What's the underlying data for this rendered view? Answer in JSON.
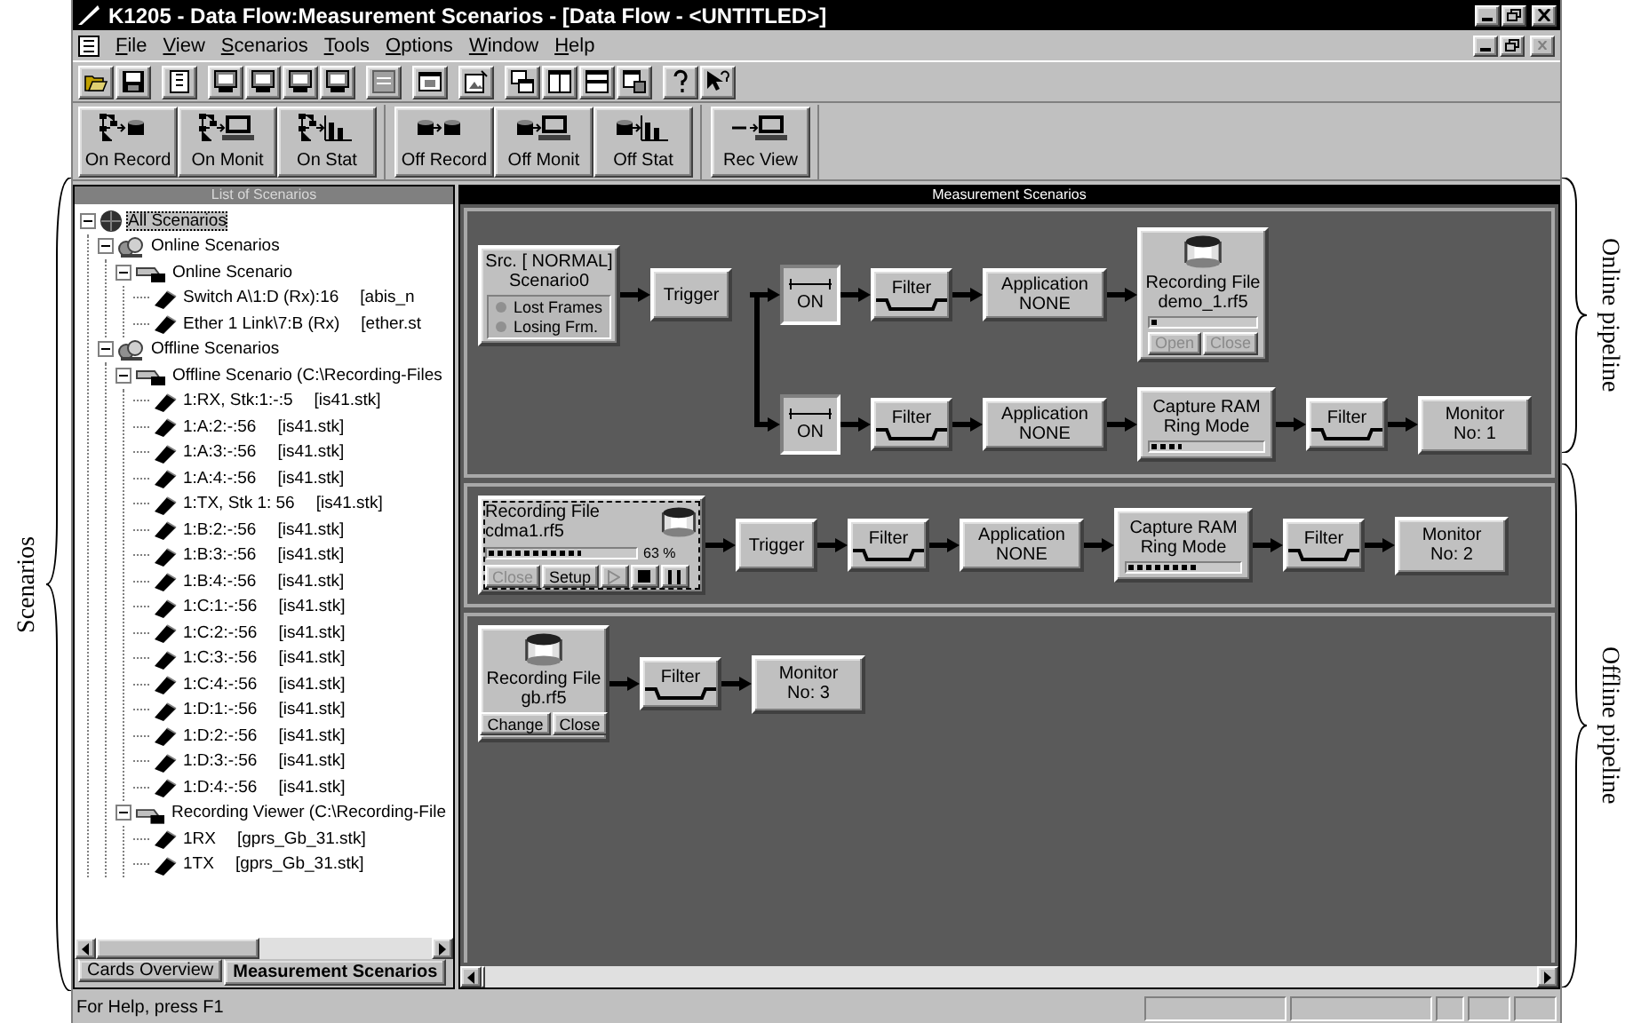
{
  "window": {
    "title": "K1205 - Data Flow:Measurement Scenarios - [Data Flow - <UNTITLED>]"
  },
  "menu": [
    {
      "label": "File"
    },
    {
      "label": "View"
    },
    {
      "label": "Scenarios"
    },
    {
      "label": "Tools"
    },
    {
      "label": "Options"
    },
    {
      "label": "Window"
    },
    {
      "label": "Help"
    }
  ],
  "button_groups": [
    [
      {
        "label": "On Record",
        "kind": "online_record"
      },
      {
        "label": "On Monit",
        "kind": "online_monitor"
      },
      {
        "label": "On Stat",
        "kind": "online_stat"
      }
    ],
    [
      {
        "label": "Off Record",
        "kind": "offline_record"
      },
      {
        "label": "Off Monit",
        "kind": "offline_monitor"
      },
      {
        "label": "Off Stat",
        "kind": "offline_stat"
      }
    ],
    [
      {
        "label": "Rec View",
        "kind": "viewer_monitor"
      }
    ]
  ],
  "scenario_list": {
    "title": "List of Scenarios",
    "tree": [
      {
        "kind": "root",
        "label": "All Scenarios",
        "selected": true,
        "expanded": true,
        "children": [
          {
            "kind": "group",
            "label": "Online Scenarios",
            "selected": false,
            "expanded": true,
            "children": [
              {
                "kind": "scenario",
                "label": "Online Scenario",
                "selected": false,
                "expanded": true,
                "children": [
                  {
                    "kind": "channel",
                    "label": "Switch A\\1:D (Rx):16",
                    "file": "[abis_n",
                    "selected": false
                  },
                  {
                    "kind": "channel",
                    "label": "Ether 1 Link\\7:B (Rx)",
                    "file": "[ether.st",
                    "selected": false
                  }
                ]
              }
            ]
          },
          {
            "kind": "group",
            "label": "Offline Scenarios",
            "selected": false,
            "expanded": true,
            "children": [
              {
                "kind": "scenario",
                "label": "Offline Scenario (C:\\Recording-Files",
                "selected": false,
                "expanded": true,
                "children": [
                  {
                    "kind": "channel",
                    "label": "1:RX, Stk:1:-:5",
                    "file": "[is41.stk]",
                    "selected": false
                  },
                  {
                    "kind": "channel",
                    "label": "1:A:2:-:56",
                    "file": "[is41.stk]",
                    "selected": false
                  },
                  {
                    "kind": "channel",
                    "label": "1:A:3:-:56",
                    "file": "[is41.stk]",
                    "selected": false
                  },
                  {
                    "kind": "channel",
                    "label": "1:A:4:-:56",
                    "file": "[is41.stk]",
                    "selected": false
                  },
                  {
                    "kind": "channel",
                    "label": "1:TX, Stk 1: 56",
                    "file": "[is41.stk]",
                    "selected": false
                  },
                  {
                    "kind": "channel",
                    "label": "1:B:2:-:56",
                    "file": "[is41.stk]",
                    "selected": false
                  },
                  {
                    "kind": "channel",
                    "label": "1:B:3:-:56",
                    "file": "[is41.stk]",
                    "selected": false
                  },
                  {
                    "kind": "channel",
                    "label": "1:B:4:-:56",
                    "file": "[is41.stk]",
                    "selected": false
                  },
                  {
                    "kind": "channel",
                    "label": "1:C:1:-:56",
                    "file": "[is41.stk]",
                    "selected": false
                  },
                  {
                    "kind": "channel",
                    "label": "1:C:2:-:56",
                    "file": "[is41.stk]",
                    "selected": false
                  },
                  {
                    "kind": "channel",
                    "label": "1:C:3:-:56",
                    "file": "[is41.stk]",
                    "selected": false
                  },
                  {
                    "kind": "channel",
                    "label": "1:C:4:-:56",
                    "file": "[is41.stk]",
                    "selected": false
                  },
                  {
                    "kind": "channel",
                    "label": "1:D:1:-:56",
                    "file": "[is41.stk]",
                    "selected": false
                  },
                  {
                    "kind": "channel",
                    "label": "1:D:2:-:56",
                    "file": "[is41.stk]",
                    "selected": false
                  },
                  {
                    "kind": "channel",
                    "label": "1:D:3:-:56",
                    "file": "[is41.stk]",
                    "selected": false
                  },
                  {
                    "kind": "channel",
                    "label": "1:D:4:-:56",
                    "file": "[is41.stk]",
                    "selected": false
                  }
                ]
              },
              {
                "kind": "scenario",
                "label": "Recording Viewer (C:\\Recording-File",
                "selected": false,
                "expanded": true,
                "children": [
                  {
                    "kind": "channel",
                    "label": "1RX",
                    "file": "[gprs_Gb_31.stk]",
                    "selected": false
                  },
                  {
                    "kind": "channel",
                    "label": "1TX",
                    "file": "[gprs_Gb_31.stk]",
                    "selected": false
                  }
                ]
              }
            ]
          }
        ]
      }
    ]
  },
  "left_tabs": [
    {
      "label": "Cards Overview",
      "selected": false
    },
    {
      "label": "Measurement Scenarios",
      "selected": true
    }
  ],
  "canvas": {
    "title": "Measurement Scenarios",
    "pipelines": [
      {
        "kind": "online",
        "stages": [
          {
            "kind": "source",
            "lines": [
              "Src. [ NORMAL]",
              "Scenario0"
            ],
            "indicators": [
              "Lost Frames",
              "Losing Frm."
            ]
          },
          {
            "kind": "trigger",
            "lines": [
              "Trigger"
            ]
          }
        ],
        "branches": [
          [
            {
              "kind": "switch",
              "lines": [
                "ON"
              ]
            },
            {
              "kind": "filter",
              "lines": [
                "Filter"
              ]
            },
            {
              "kind": "application",
              "lines": [
                "Application",
                "NONE"
              ]
            },
            {
              "kind": "recording",
              "lines": [
                "Recording File",
                "demo_1.rf5"
              ],
              "level": 0.05,
              "controls": [
                {
                  "kind": "text",
                  "label": "Open",
                  "disabled": true
                },
                {
                  "kind": "text",
                  "label": "Close",
                  "disabled": true
                }
              ]
            }
          ],
          [
            {
              "kind": "switch",
              "lines": [
                "ON"
              ]
            },
            {
              "kind": "filter",
              "lines": [
                "Filter"
              ]
            },
            {
              "kind": "application",
              "lines": [
                "Application",
                "NONE"
              ]
            },
            {
              "kind": "capture",
              "lines": [
                "Capture RAM",
                "Ring Mode"
              ],
              "level": 0.27
            },
            {
              "kind": "filter",
              "lines": [
                "Filter"
              ]
            },
            {
              "kind": "monitor",
              "lines": [
                "Monitor",
                "No: 1"
              ]
            }
          ]
        ]
      },
      {
        "kind": "offline",
        "stages": [
          {
            "kind": "player",
            "lines": [
              "Recording File",
              "cdma1.rf5"
            ],
            "level": 0.63,
            "reading": "63 %",
            "controls": [
              {
                "kind": "text",
                "label": "Close",
                "disabled": true
              },
              {
                "kind": "text",
                "label": "Setup",
                "disabled": false
              },
              {
                "kind": "play",
                "disabled": true
              },
              {
                "kind": "stop",
                "disabled": false
              },
              {
                "kind": "pause",
                "disabled": false
              }
            ]
          },
          {
            "kind": "trigger",
            "lines": [
              "Trigger"
            ]
          },
          {
            "kind": "filter",
            "lines": [
              "Filter"
            ]
          },
          {
            "kind": "application",
            "lines": [
              "Application",
              "NONE"
            ]
          },
          {
            "kind": "capture",
            "lines": [
              "Capture RAM",
              "Ring Mode"
            ],
            "level": 0.65
          },
          {
            "kind": "filter",
            "lines": [
              "Filter"
            ]
          },
          {
            "kind": "monitor",
            "lines": [
              "Monitor",
              "No: 2"
            ]
          }
        ]
      },
      {
        "kind": "offline",
        "stages": [
          {
            "kind": "recording",
            "lines": [
              "Recording File",
              "gb.rf5"
            ],
            "controls": [
              {
                "kind": "text",
                "label": "Change",
                "disabled": false
              },
              {
                "kind": "text",
                "label": "Close",
                "disabled": false
              }
            ]
          },
          {
            "kind": "filter",
            "lines": [
              "Filter"
            ]
          },
          {
            "kind": "monitor",
            "lines": [
              "Monitor",
              "No: 3"
            ]
          }
        ]
      }
    ]
  },
  "status_bar": {
    "text": "For Help, press F1"
  },
  "annotations": {
    "left": "Scenarios",
    "right": [
      "Online pipeline",
      "Offline pipeline"
    ]
  }
}
